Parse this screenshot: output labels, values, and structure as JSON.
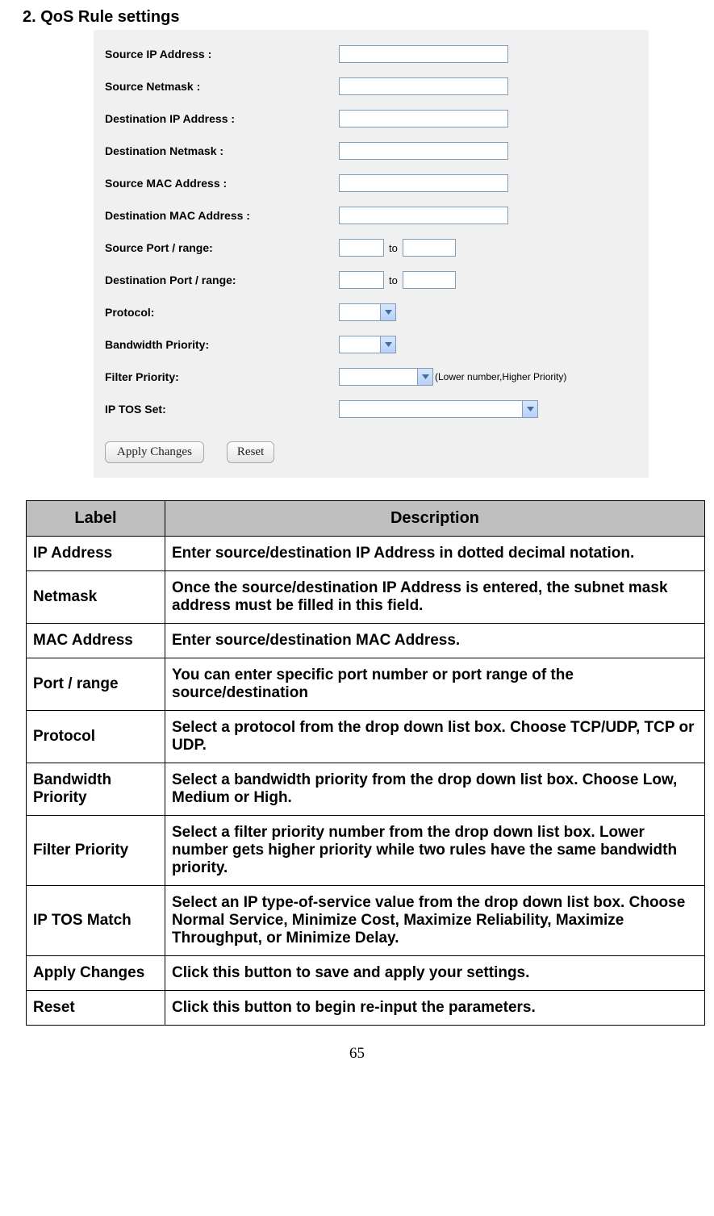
{
  "heading": "2.    QoS Rule settings",
  "form": {
    "source_ip_label": "Source IP Address :",
    "source_netmask_label": "Source Netmask :",
    "dest_ip_label": "Destination IP Address :",
    "dest_netmask_label": "Destination Netmask :",
    "source_mac_label": "Source MAC Address :",
    "dest_mac_label": "Destination MAC Address :",
    "source_port_label": "Source Port / range:",
    "dest_port_label": "Destination Port / range:",
    "to_label": "to",
    "protocol_label": "Protocol:",
    "bandwidth_priority_label": "Bandwidth Priority:",
    "filter_priority_label": "Filter Priority:",
    "filter_priority_hint": "(Lower number,Higher Priority)",
    "ip_tos_label": "IP TOS Set:",
    "source_ip_value": "",
    "source_netmask_value": "",
    "dest_ip_value": "",
    "dest_netmask_value": "",
    "source_mac_value": "",
    "dest_mac_value": "",
    "source_port_from": "",
    "source_port_to": "",
    "dest_port_from": "",
    "dest_port_to": "",
    "protocol_value": "",
    "bandwidth_priority_value": "",
    "filter_priority_value": "",
    "ip_tos_value": ""
  },
  "buttons": {
    "apply_label": "Apply Changes",
    "reset_label": "Reset"
  },
  "table": {
    "header_label": "Label",
    "header_description": "Description",
    "rows": [
      {
        "label": "IP Address",
        "desc": "Enter source/destination IP Address in dotted decimal notation."
      },
      {
        "label": "Netmask",
        "desc": "Once the source/destination IP Address is entered, the subnet mask address must be filled in this field."
      },
      {
        "label": "MAC Address",
        "desc": "Enter source/destination MAC Address."
      },
      {
        "label": "Port / range",
        "desc": "You can enter specific port number or port range of the source/destination"
      },
      {
        "label": "Protocol",
        "desc": "Select a protocol from the drop down list box. Choose TCP/UDP, TCP or UDP."
      },
      {
        "label": "Bandwidth Priority",
        "desc": "Select a bandwidth priority from the drop down list box. Choose Low, Medium or High."
      },
      {
        "label": "Filter Priority",
        "desc": "Select a filter priority number from the drop down list box. Lower number gets higher priority while two rules have the same bandwidth priority."
      },
      {
        "label": "IP TOS Match",
        "desc": "Select an IP type-of-service value from the drop down list box. Choose Normal Service, Minimize Cost, Maximize Reliability, Maximize Throughput, or Minimize Delay."
      },
      {
        "label": "Apply Changes",
        "desc": "Click this button to save and apply your settings."
      },
      {
        "label": "Reset",
        "desc": "Click this button to begin re-input the parameters."
      }
    ]
  },
  "page_number": "65"
}
